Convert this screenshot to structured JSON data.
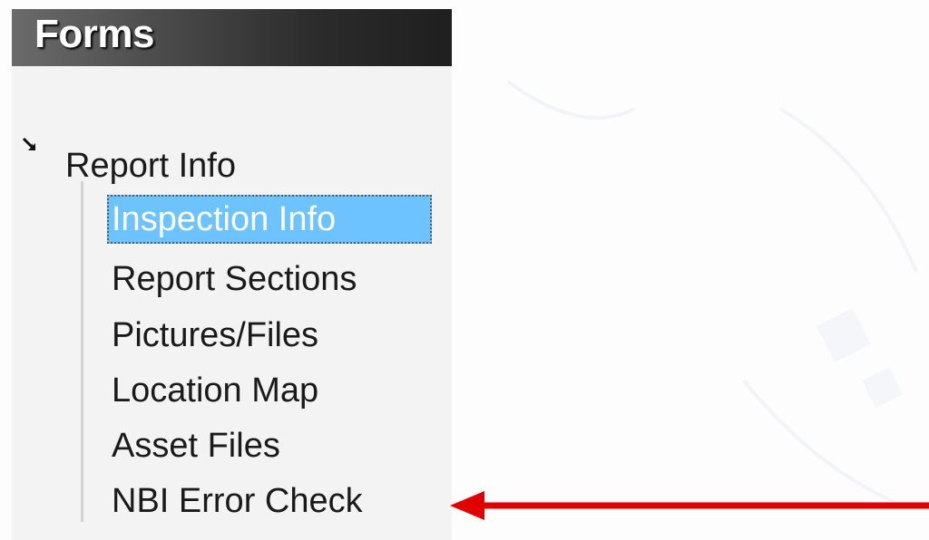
{
  "panel": {
    "title": "Forms"
  },
  "tree": {
    "root": {
      "label": "Report Info",
      "expanded": true,
      "toggle_icon": "expanded-arrow-icon"
    },
    "children": [
      {
        "label": "Inspection Info",
        "selected": true
      },
      {
        "label": "Report Sections",
        "selected": false
      },
      {
        "label": "Pictures/Files",
        "selected": false
      },
      {
        "label": "Location Map",
        "selected": false
      },
      {
        "label": "Asset Files",
        "selected": false
      },
      {
        "label": "NBI Error Check",
        "selected": false
      }
    ]
  },
  "annotation": {
    "type": "arrow",
    "color": "#e00000",
    "points_to": "NBI Error Check"
  },
  "colors": {
    "header_dark": "#1f1f1f",
    "panel_bg": "#f3f3f3",
    "selection": "#6cc3ff"
  }
}
